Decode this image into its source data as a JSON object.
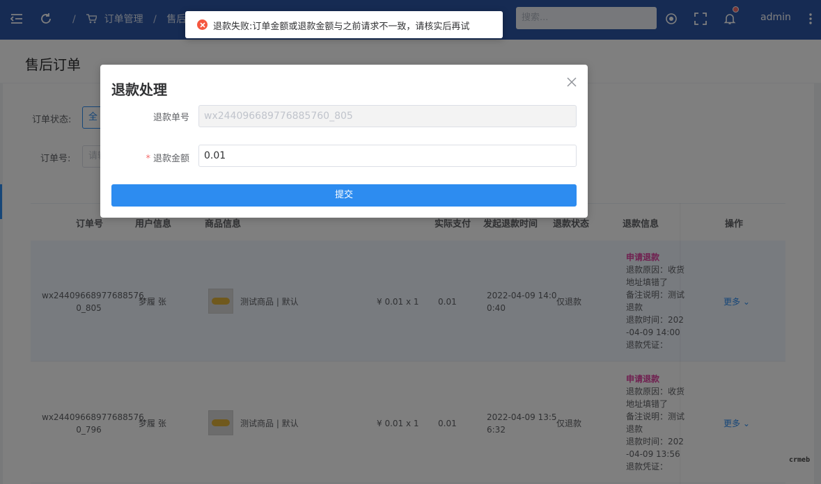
{
  "topbar": {
    "breadcrumb": [
      "订单管理",
      "售后订单"
    ],
    "search_placeholder": "搜索...",
    "user": "admin"
  },
  "page": {
    "title": "售后订单"
  },
  "filters": {
    "status_label": "订单状态:",
    "status_value": "全",
    "order_no_label": "订单号:",
    "order_no_placeholder": "请输"
  },
  "table": {
    "headers": [
      "订单号",
      "用户信息",
      "商品信息",
      "实际支付",
      "发起退款时间",
      "退款状态",
      "退款信息",
      "操作"
    ],
    "rows": [
      {
        "order_no_1": "wx24409668977688576",
        "order_no_2": "0_805",
        "user": "梦履 张",
        "product": "测试商品 | 默认",
        "price": "¥ 0.01 x 1",
        "paid": "0.01",
        "time_1": "2022-04-09 14:0",
        "time_2": "0:40",
        "refund_status": "仅退款",
        "info": [
          "申请退款",
          "退款原因：收货",
          "地址填错了",
          "备注说明：测试",
          "退款",
          "退款时间：202",
          "-04-09 14:00",
          "退款凭证："
        ],
        "action": "更多"
      },
      {
        "order_no_1": "wx24409668977688576",
        "order_no_2": "0_796",
        "user": "梦履 张",
        "product": "测试商品 | 默认",
        "price": "¥ 0.01 x 1",
        "paid": "0.01",
        "time_1": "2022-04-09 13:5",
        "time_2": "6:32",
        "refund_status": "仅退款",
        "info": [
          "申请退款",
          "退款原因：收货",
          "地址填错了",
          "备注说明：测试",
          "退款",
          "退款时间：202",
          "-04-09 13:56",
          "退款凭证："
        ],
        "action": "更多"
      }
    ]
  },
  "modal": {
    "title": "退款处理",
    "refund_no_label": "退款单号",
    "refund_no_value": "wx244096689776885760_805",
    "amount_label": "退款金额",
    "required_mark": "*",
    "amount_value": "0.01",
    "submit_label": "提交"
  },
  "toast": {
    "message": "退款失败:订单金额或退款金额与之前请求不一致，请核实后再试"
  },
  "watermark": "crmeb",
  "colors": {
    "topbar": "#2c56a6",
    "primary": "#2d8cf0",
    "error": "#f5573f",
    "refund_status": "#e040a0"
  }
}
